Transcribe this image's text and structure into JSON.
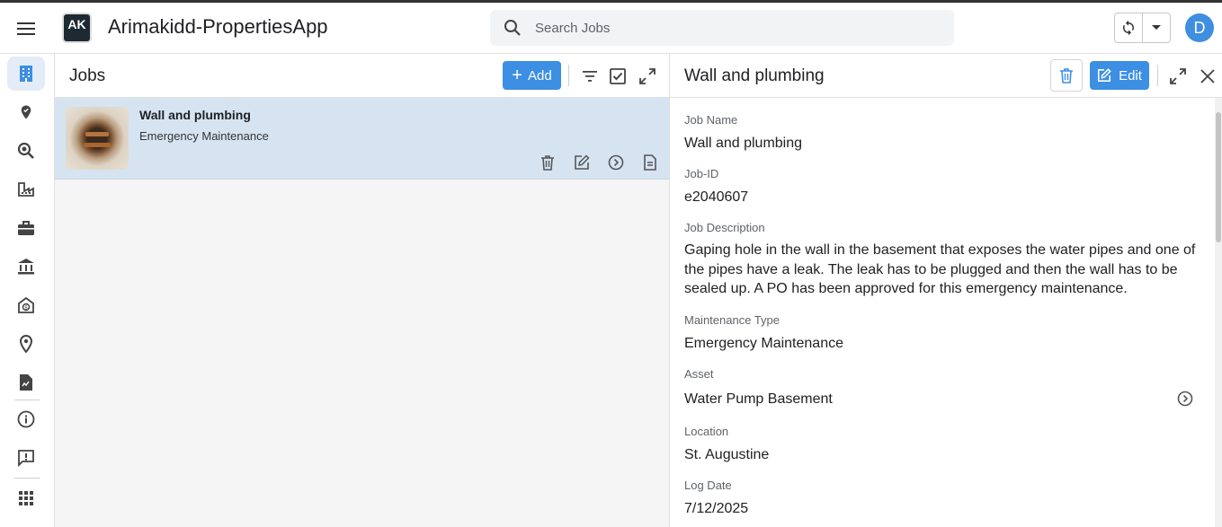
{
  "app": {
    "title": "Arimakidd-PropertiesApp",
    "logo_text": "AK",
    "avatar_initial": "D"
  },
  "search": {
    "placeholder": "Search Jobs"
  },
  "jobs_panel": {
    "title": "Jobs",
    "add_label": "Add",
    "items": [
      {
        "name": "Wall and plumbing",
        "type": "Emergency Maintenance"
      }
    ]
  },
  "detail": {
    "title": "Wall and plumbing",
    "edit_label": "Edit",
    "fields": [
      {
        "label": "Job Name",
        "value": "Wall and plumbing"
      },
      {
        "label": "Job-ID",
        "value": "e2040607"
      },
      {
        "label": "Job Description",
        "value": "Gaping hole in the wall in the basement that exposes the water pipes and one of the pipes have a leak.  The leak has to be plugged and then the wall has to be sealed up.  A PO has been approved for this emergency maintenance."
      },
      {
        "label": "Maintenance Type",
        "value": "Emergency Maintenance"
      },
      {
        "label": "Asset",
        "value": "Water Pump Basement"
      },
      {
        "label": "Location",
        "value": "St. Augustine"
      },
      {
        "label": "Log Date",
        "value": "7/12/2025"
      }
    ]
  },
  "colors": {
    "accent": "#3c8fe2",
    "selected_row": "#d6e4f2",
    "rail_active": "#e3ecf7",
    "icon": "#444444"
  },
  "icons": {
    "rail": [
      "building-icon",
      "verified-location-icon",
      "search-zoom-icon",
      "factory-icon",
      "briefcase-icon",
      "bank-icon",
      "money-envelope-icon",
      "location-pin-icon",
      "document-icon",
      "info-icon",
      "feedback-icon",
      "apps-grid-icon"
    ]
  }
}
